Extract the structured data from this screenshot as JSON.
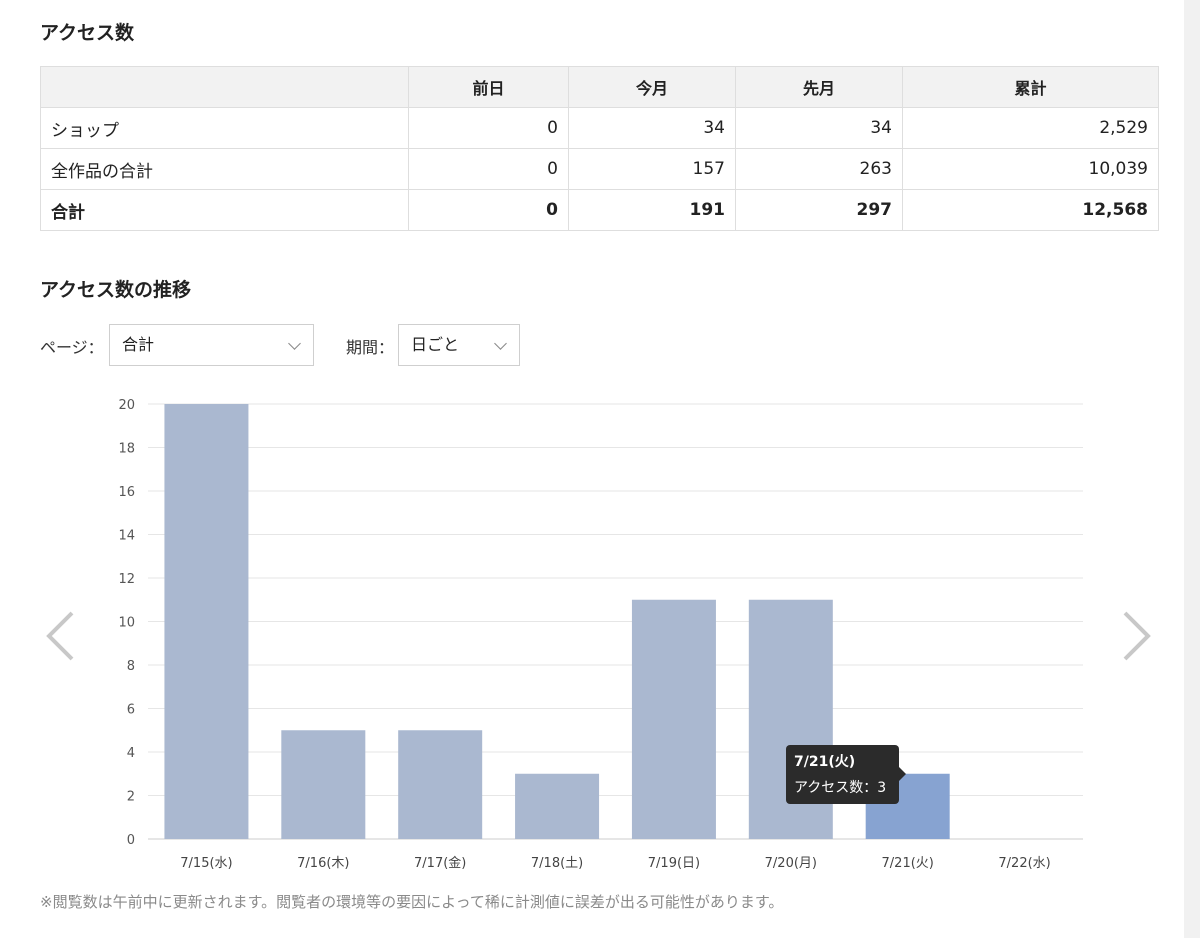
{
  "access": {
    "title": "アクセス数",
    "columns": [
      "",
      "前日",
      "今月",
      "先月",
      "累計"
    ],
    "rows": [
      {
        "label": "ショップ",
        "values": [
          "0",
          "34",
          "34",
          "2,529"
        ]
      },
      {
        "label": "全作品の合計",
        "values": [
          "0",
          "157",
          "263",
          "10,039"
        ]
      },
      {
        "label": "合計",
        "values": [
          "0",
          "191",
          "297",
          "12,568"
        ]
      }
    ]
  },
  "trend": {
    "title": "アクセス数の推移",
    "page_filter": {
      "label": "ページ：",
      "value": "合計"
    },
    "period_filter": {
      "label": "期間：",
      "value": "日ごと"
    }
  },
  "chart_data": {
    "type": "bar",
    "categories": [
      "7/15(水)",
      "7/16(木)",
      "7/17(金)",
      "7/18(土)",
      "7/19(日)",
      "7/20(月)",
      "7/21(火)",
      "7/22(水)"
    ],
    "values": [
      20,
      5,
      5,
      3,
      11,
      11,
      3,
      0
    ],
    "ylim": [
      0,
      20
    ],
    "yticks": [
      0,
      2,
      4,
      6,
      8,
      10,
      12,
      14,
      16,
      18,
      20
    ],
    "grid": true,
    "highlighted_index": 6,
    "colors": {
      "bar": "#aab8d0",
      "highlight": "#87a3d1",
      "grid": "#e6e6e6"
    }
  },
  "tooltip": {
    "title": "7/21(火)",
    "text": "アクセス数：3"
  },
  "footnote": "※閲覧数は午前中に更新されます。閲覧者の環境等の要因によって稀に計測値に誤差が出る可能性があります。",
  "nav": {
    "prev_icon": "chevron-left-icon",
    "next_icon": "chevron-right-icon"
  }
}
